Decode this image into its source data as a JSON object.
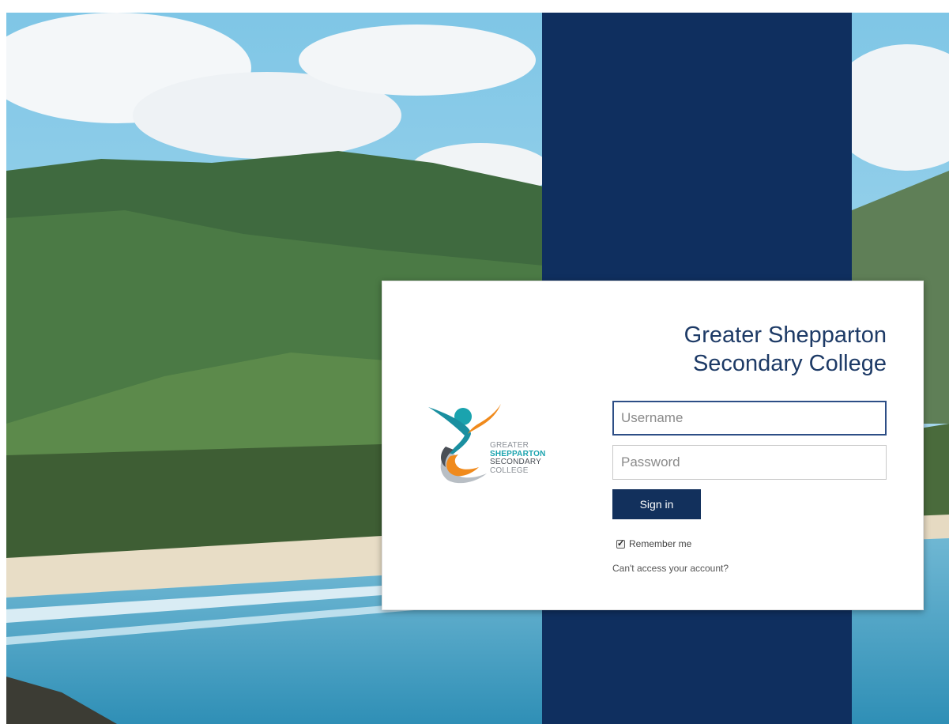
{
  "org": {
    "title_line1": "Greater Shepparton",
    "title_line2": "Secondary College"
  },
  "logo": {
    "icon": "college-logo-figure-icon",
    "line1": "GREATER",
    "line2": "SHEPPARTON",
    "line3": "SECONDARY",
    "line4": "COLLEGE"
  },
  "form": {
    "username": {
      "value": "",
      "placeholder": "Username"
    },
    "password": {
      "value": "",
      "placeholder": "Password"
    },
    "signin_label": "Sign in",
    "remember_label": "Remember me",
    "remember_checked": true,
    "cant_access_label": "Can't access your account?"
  },
  "icons": {
    "checkbox": "check-icon"
  },
  "colors": {
    "navy_band": "#0f2f5f",
    "title": "#1d3a66",
    "button": "#12305c",
    "logo_teal": "#1aa3ae",
    "logo_orange": "#f08a1c"
  }
}
